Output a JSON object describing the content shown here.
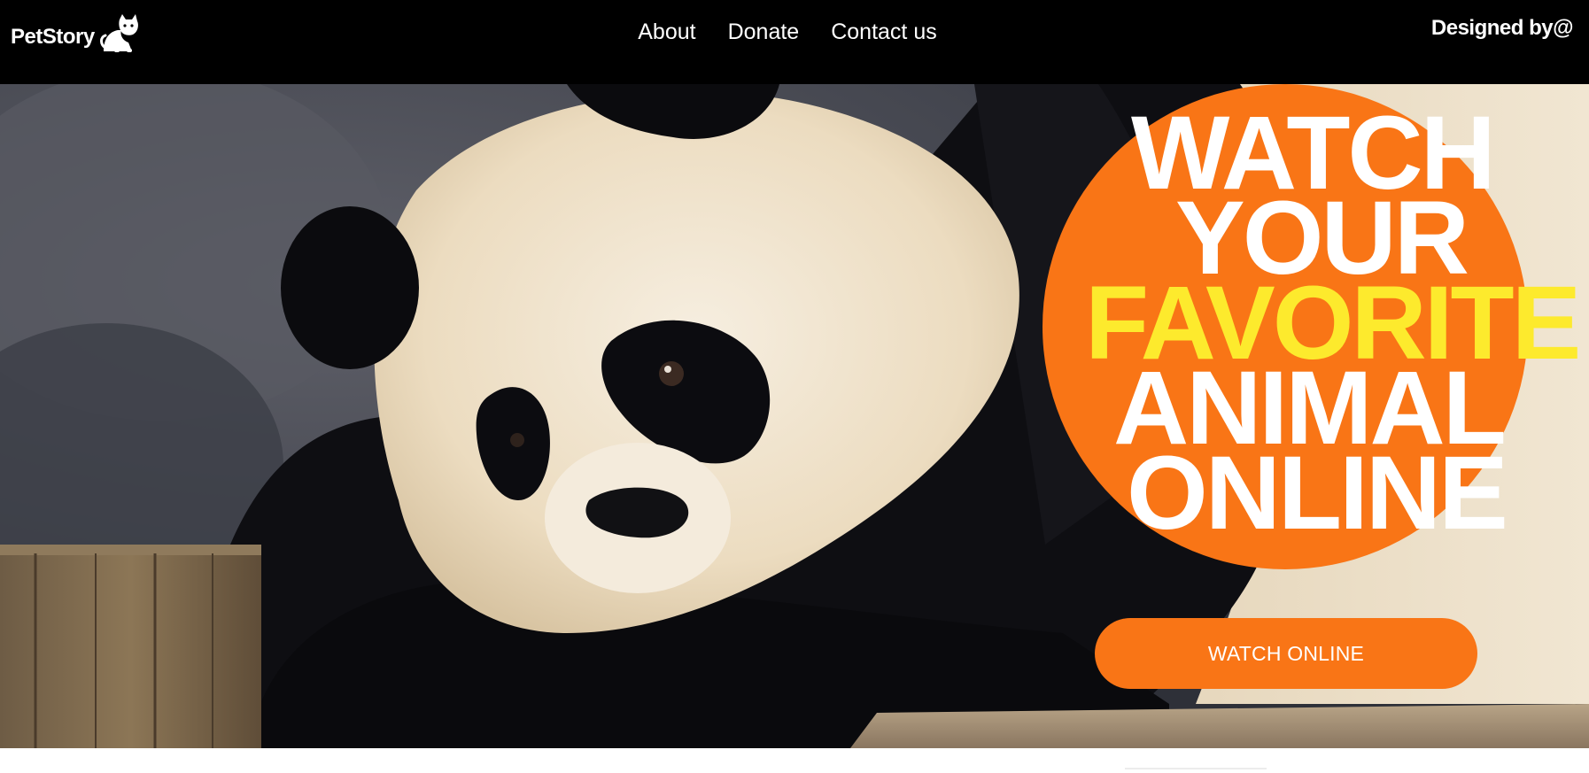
{
  "header": {
    "brand": "PetStory",
    "brand_icon": "cat-icon",
    "nav": [
      "About",
      "Donate",
      "Contact us"
    ],
    "credit": "Designed by@"
  },
  "hero": {
    "headline": [
      "WATCH",
      "YOUR",
      "FAVORITE",
      "ANIMAL",
      "ONLINE"
    ],
    "cta_label": "WATCH ONLINE",
    "image_subject": "giant panda"
  },
  "colors": {
    "header_bg": "#000000",
    "accent_orange": "#f97516",
    "highlight_yellow": "#fdea2d",
    "text_light": "#ffffff"
  }
}
